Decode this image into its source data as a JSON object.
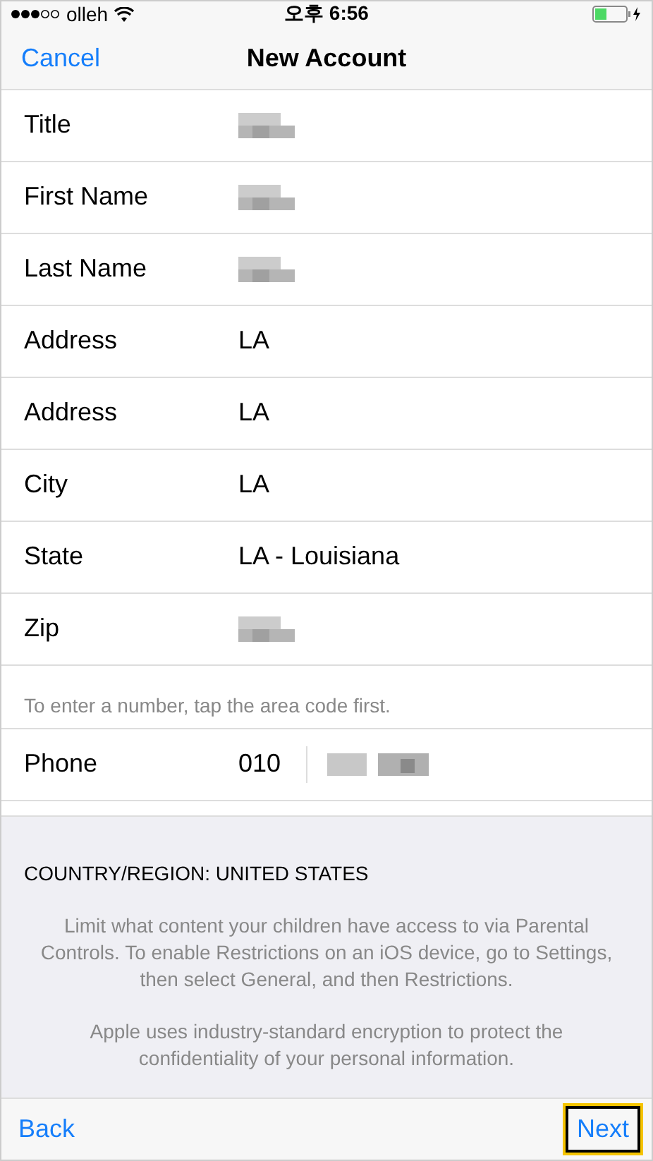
{
  "status_bar": {
    "carrier": "olleh",
    "time": "오후 6:56"
  },
  "nav_bar": {
    "left_button": "Cancel",
    "title": "New Account"
  },
  "fields": [
    {
      "label": "Title",
      "kind": "redacted"
    },
    {
      "label": "First Name",
      "kind": "redacted"
    },
    {
      "label": "Last Name",
      "kind": "redacted"
    },
    {
      "label": "Address",
      "kind": "text",
      "value": "LA"
    },
    {
      "label": "Address",
      "kind": "text",
      "value": "LA"
    },
    {
      "label": "City",
      "kind": "text",
      "value": "LA"
    },
    {
      "label": "State",
      "kind": "text",
      "value": "LA - Louisiana"
    },
    {
      "label": "Zip",
      "kind": "redacted"
    }
  ],
  "phone_hint": "To enter a number, tap the area code first.",
  "phone": {
    "label": "Phone",
    "area_code": "010",
    "kind": "redacted"
  },
  "footer": {
    "heading": "COUNTRY/REGION: UNITED STATES",
    "paragraphs": [
      "Limit what content your children have access to via Parental Controls. To enable Restrictions on an iOS device, go to Settings, then select General, and then Restrictions.",
      "Apple uses industry-standard encryption to protect the confidentiality of your personal information."
    ]
  },
  "toolbar": {
    "back": "Back",
    "next": "Next",
    "next_highlighted": true
  }
}
